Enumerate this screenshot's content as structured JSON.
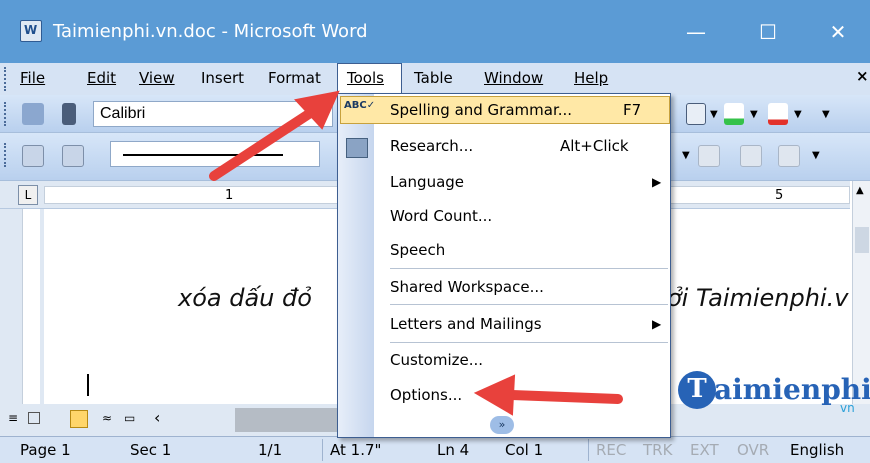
{
  "window": {
    "title": "Taimienphi.vn.doc - Microsoft Word",
    "minimize_glyph": "—",
    "maximize_glyph": "☐",
    "close_glyph": "✕"
  },
  "menubar": {
    "items": [
      {
        "label": "File",
        "name": "menu-file"
      },
      {
        "label": "Edit",
        "name": "menu-edit"
      },
      {
        "label": "View",
        "name": "menu-view"
      },
      {
        "label": "Insert",
        "name": "menu-insert"
      },
      {
        "label": "Format",
        "name": "menu-format"
      },
      {
        "label": "Tools",
        "name": "menu-tools"
      },
      {
        "label": "Table",
        "name": "menu-table"
      },
      {
        "label": "Window",
        "name": "menu-window"
      },
      {
        "label": "Help",
        "name": "menu-help"
      }
    ],
    "close_glyph": "×"
  },
  "toolbar": {
    "font_name": "Calibri"
  },
  "ruler": {
    "tab_glyph": "L",
    "marks": [
      "1",
      "5"
    ]
  },
  "document": {
    "text_left": "xóa dấu đỏ",
    "text_right": "ởi Taimienphi.v"
  },
  "tools_menu": {
    "items": [
      {
        "label": "Spelling and Grammar...",
        "shortcut": "F7",
        "icon": "spelling-abc-icon"
      },
      {
        "label": "Research...",
        "shortcut": "Alt+Click",
        "icon": "research-book-icon"
      },
      {
        "label": "Language",
        "submenu": true
      },
      {
        "label": "Word Count..."
      },
      {
        "label": "Speech"
      },
      {
        "label": "Shared Workspace..."
      },
      {
        "label": "Letters and Mailings",
        "submenu": true
      },
      {
        "label": "Customize..."
      },
      {
        "label": "Options..."
      }
    ],
    "submenu_glyph": "▶",
    "expand_glyph": "»"
  },
  "statusbar": {
    "page": "Page 1",
    "sec": "Sec 1",
    "pages": "1/1",
    "at": "At 1.7\"",
    "ln": "Ln 4",
    "col": "Col 1",
    "rec": "REC",
    "trk": "TRK",
    "ext": "EXT",
    "ovr": "OVR",
    "lang": "English"
  },
  "logo": {
    "letter": "T",
    "text": "aimienphi",
    "suffix": "vn"
  },
  "colors": {
    "titlebar": "#5b9bd5",
    "menubar": "#d6e3f4",
    "highlight": "#ffe8a6",
    "annotation_arrow": "#e8413c",
    "logo_blue": "#2763b6"
  }
}
